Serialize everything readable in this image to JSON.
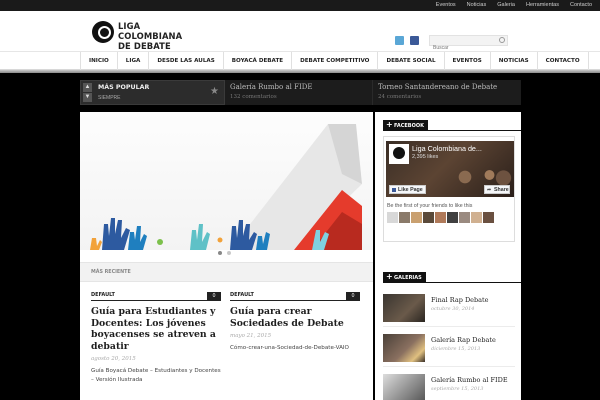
{
  "topbar": {
    "links": [
      "Eventos",
      "Noticias",
      "Galeria",
      "Herramientas",
      "Contacto"
    ]
  },
  "header": {
    "logo_line1": "LIGA COLOMBIANA",
    "logo_line2": "DE DEBATE",
    "search_placeholder": "Buscar",
    "icons": [
      "twitter-icon",
      "facebook-icon",
      "search-icon"
    ]
  },
  "nav": {
    "items": [
      "INICIO",
      "LIGA",
      "DESDE LAS AULAS",
      "BOYACÁ DEBATE",
      "DEBATE COMPETITIVO",
      "DEBATE SOCIAL",
      "EVENTOS",
      "NOTICIAS",
      "CONTACTO"
    ]
  },
  "ticker": {
    "title": "MÁS POPULAR",
    "subtitle": "SIEMPRE",
    "items": [
      {
        "title": "Galería Rumbo al FIDE",
        "comments": "132 comentarios"
      },
      {
        "title": "Torneo Santandereano de Debate",
        "comments": "24 comentarios"
      }
    ]
  },
  "recent": {
    "label": "MÁS RECIENTE"
  },
  "posts": [
    {
      "category": "DEFAULT",
      "comments": "0",
      "title": "Guía para Estudiantes y Docentes: Los jóvenes boyacenses se atreven a debatir",
      "date": "agosto 20, 2015",
      "excerpt": "Guía Boyacá Debate – Estudiantes y Docentes – Versión Ilustrada"
    },
    {
      "category": "DEFAULT",
      "comments": "0",
      "title": "Guía para crear Sociedades de Debate",
      "date": "mayo 21, 2015",
      "excerpt": "Cómo-crear-una-Sociedad-de-Debate-VAIO"
    }
  ],
  "sidebar": {
    "facebook_title": "FACEBOOK",
    "fb_name": "Liga Colombiana de...",
    "fb_likes": "2,395 likes",
    "fb_like_btn": "Like Page",
    "fb_share_btn": "Share",
    "fb_friends_text": "Be the first of your friends to like this",
    "galleries_title": "GALERIAS",
    "galleries": [
      {
        "title": "Final Rap Debate",
        "date": "octubre 30, 2014"
      },
      {
        "title": "Galería Rap Debate",
        "date": "diciembre 15, 2013"
      },
      {
        "title": "Galería Rumbo al FIDE",
        "date": "septiembre 15, 2013"
      }
    ]
  },
  "colors": {
    "page_bg": "#000000",
    "accent_red": "#e53b2c",
    "dark_bar": "#1a1a1a"
  }
}
